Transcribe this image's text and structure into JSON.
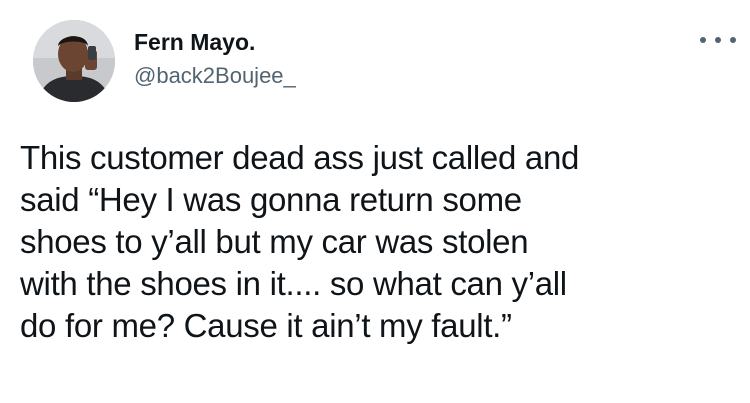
{
  "tweet": {
    "display_name": "Fern Mayo.",
    "handle": "@back2Boujee_",
    "more_icon": "more-horizontal-icon",
    "text": "This customer dead ass just called and\nsaid “Hey I was gonna return some\nshoes to y’all but my car was stolen\nwith the shoes in it.... so what can y’all\ndo for me? Cause it ain’t my fault.”"
  },
  "colors": {
    "text": "#0f1419",
    "secondary": "#536471",
    "background": "#ffffff"
  }
}
